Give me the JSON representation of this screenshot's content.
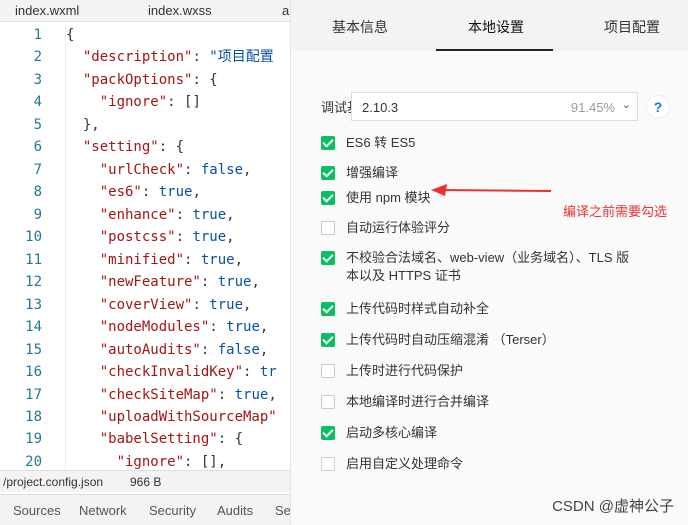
{
  "editor": {
    "file_tabs": [
      "index.wxml",
      "index.wxss",
      "a"
    ],
    "lines": [
      [
        [
          "p",
          "{"
        ]
      ],
      [
        [
          "p",
          "  "
        ],
        [
          "k",
          "\"description\""
        ],
        [
          "p",
          ": "
        ],
        [
          "s",
          "\"项目配置"
        ]
      ],
      [
        [
          "p",
          "  "
        ],
        [
          "k",
          "\"packOptions\""
        ],
        [
          "p",
          ": {"
        ]
      ],
      [
        [
          "p",
          "    "
        ],
        [
          "k",
          "\"ignore\""
        ],
        [
          "p",
          ": []"
        ]
      ],
      [
        [
          "p",
          "  },"
        ]
      ],
      [
        [
          "p",
          "  "
        ],
        [
          "k",
          "\"setting\""
        ],
        [
          "p",
          ": {"
        ]
      ],
      [
        [
          "p",
          "    "
        ],
        [
          "k",
          "\"urlCheck\""
        ],
        [
          "p",
          ": "
        ],
        [
          "v",
          "false"
        ],
        [
          "p",
          ","
        ]
      ],
      [
        [
          "p",
          "    "
        ],
        [
          "k",
          "\"es6\""
        ],
        [
          "p",
          ": "
        ],
        [
          "v",
          "true"
        ],
        [
          "p",
          ","
        ]
      ],
      [
        [
          "p",
          "    "
        ],
        [
          "k",
          "\"enhance\""
        ],
        [
          "p",
          ": "
        ],
        [
          "v",
          "true"
        ],
        [
          "p",
          ","
        ]
      ],
      [
        [
          "p",
          "    "
        ],
        [
          "k",
          "\"postcss\""
        ],
        [
          "p",
          ": "
        ],
        [
          "v",
          "true"
        ],
        [
          "p",
          ","
        ]
      ],
      [
        [
          "p",
          "    "
        ],
        [
          "k",
          "\"minified\""
        ],
        [
          "p",
          ": "
        ],
        [
          "v",
          "true"
        ],
        [
          "p",
          ","
        ]
      ],
      [
        [
          "p",
          "    "
        ],
        [
          "k",
          "\"newFeature\""
        ],
        [
          "p",
          ": "
        ],
        [
          "v",
          "true"
        ],
        [
          "p",
          ","
        ]
      ],
      [
        [
          "p",
          "    "
        ],
        [
          "k",
          "\"coverView\""
        ],
        [
          "p",
          ": "
        ],
        [
          "v",
          "true"
        ],
        [
          "p",
          ","
        ]
      ],
      [
        [
          "p",
          "    "
        ],
        [
          "k",
          "\"nodeModules\""
        ],
        [
          "p",
          ": "
        ],
        [
          "v",
          "true"
        ],
        [
          "p",
          ","
        ]
      ],
      [
        [
          "p",
          "    "
        ],
        [
          "k",
          "\"autoAudits\""
        ],
        [
          "p",
          ": "
        ],
        [
          "v",
          "false"
        ],
        [
          "p",
          ","
        ]
      ],
      [
        [
          "p",
          "    "
        ],
        [
          "k",
          "\"checkInvalidKey\""
        ],
        [
          "p",
          ": "
        ],
        [
          "v",
          "tr"
        ]
      ],
      [
        [
          "p",
          "    "
        ],
        [
          "k",
          "\"checkSiteMap\""
        ],
        [
          "p",
          ": "
        ],
        [
          "v",
          "true"
        ],
        [
          "p",
          ","
        ]
      ],
      [
        [
          "p",
          "    "
        ],
        [
          "k",
          "\"uploadWithSourceMap\""
        ]
      ],
      [
        [
          "p",
          "    "
        ],
        [
          "k",
          "\"babelSetting\""
        ],
        [
          "p",
          ": {"
        ]
      ],
      [
        [
          "p",
          "      "
        ],
        [
          "k",
          "\"ignore\""
        ],
        [
          "p",
          ": [],"
        ]
      ]
    ],
    "status_path": "/project.config.json",
    "status_size": "966 B",
    "devtools_tabs": [
      "Sources",
      "Network",
      "Security",
      "Audits",
      "Se"
    ]
  },
  "panel": {
    "tabs": [
      "基本信息",
      "本地设置",
      "项目配置"
    ],
    "active_tab": "本地设置",
    "lib_label": "调试基础库",
    "lib_version": "2.10.3",
    "lib_percent": "91.45%",
    "help": "?",
    "options": [
      {
        "label": "ES6 转 ES5",
        "checked": true
      },
      {
        "label": "增强编译",
        "checked": true
      },
      {
        "label": "使用 npm 模块",
        "checked": true
      },
      {
        "label": "自动运行体验评分",
        "checked": false
      },
      {
        "label": "不校验合法域名、web-view（业务域名）、TLS 版",
        "label2": "本以及 HTTPS 证书",
        "checked": true
      },
      {
        "label": "上传代码时样式自动补全",
        "checked": true
      },
      {
        "label": "上传代码时自动压缩混淆 （Terser）",
        "checked": true
      },
      {
        "label": "上传时进行代码保护",
        "checked": false
      },
      {
        "label": "本地编译时进行合并编译",
        "checked": false
      },
      {
        "label": "启动多核心编译",
        "checked": true
      },
      {
        "label": "启用自定义处理命令",
        "checked": false
      }
    ],
    "annotation": "编译之前需要勾选",
    "annotation_color": "#f03030",
    "accent": "#07c160"
  },
  "watermark": "CSDN @虚神公子"
}
